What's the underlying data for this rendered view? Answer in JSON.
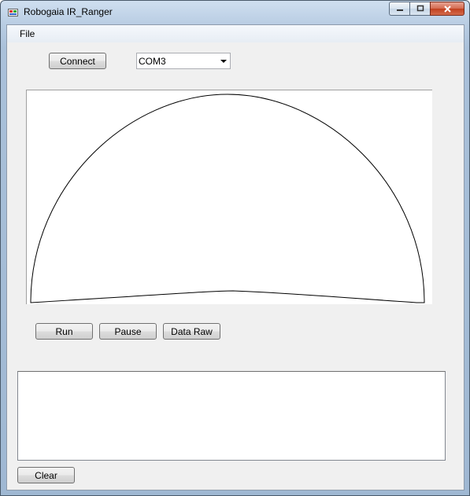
{
  "window": {
    "title": "Robogaia IR_Ranger",
    "controls": [
      "minimize",
      "maximize",
      "close"
    ]
  },
  "menu": {
    "items": [
      {
        "label": "File"
      }
    ]
  },
  "connection": {
    "connect_label": "Connect",
    "port_selected": "COM3"
  },
  "plot": {
    "description_icon": "radar-sweep-plot"
  },
  "controls": {
    "run_label": "Run",
    "pause_label": "Pause",
    "data_raw_label": "Data Raw"
  },
  "log": {
    "value": ""
  },
  "footer": {
    "clear_label": "Clear"
  }
}
